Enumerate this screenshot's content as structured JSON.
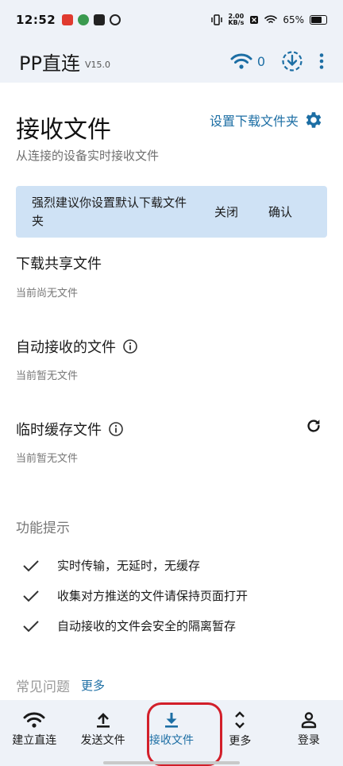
{
  "status_bar": {
    "time": "12:52",
    "net_speed_value": "2.00",
    "net_speed_unit": "KB/s",
    "battery": "65%",
    "battery_level": 0.65
  },
  "app_bar": {
    "title": "PP直连",
    "version": "V15.0",
    "connection_count": "0"
  },
  "page": {
    "title": "接收文件",
    "set_folder_label": "设置下载文件夹",
    "subtitle": "从连接的设备实时接收文件"
  },
  "banner": {
    "text": "强烈建议你设置默认下载文件夹",
    "close_label": "关闭",
    "confirm_label": "确认"
  },
  "sections": [
    {
      "title": "下载共享文件",
      "empty_text": "当前尚无文件"
    },
    {
      "title": "自动接收的文件",
      "empty_text": "当前暂无文件"
    },
    {
      "title": "临时缓存文件",
      "empty_text": "当前暂无文件"
    }
  ],
  "tips": {
    "title": "功能提示",
    "items": [
      "实时传输，无延时，无缓存",
      "收集对方推送的文件请保持页面打开",
      "自动接收的文件会安全的隔离暂存"
    ]
  },
  "faq": {
    "title": "常见问题",
    "more_label": "更多"
  },
  "bottom_nav": [
    {
      "label": "建立直连",
      "icon": "wifi-icon"
    },
    {
      "label": "发送文件",
      "icon": "upload-icon"
    },
    {
      "label": "接收文件",
      "icon": "download-icon",
      "active": true
    },
    {
      "label": "更多",
      "icon": "chevron-up-down-icon"
    },
    {
      "label": "登录",
      "icon": "person-icon"
    }
  ],
  "colors": {
    "accent": "#1c6ea4",
    "banner_bg": "#cfe2f5",
    "bar_bg": "#eef2f8",
    "highlight": "#d21f2a"
  }
}
